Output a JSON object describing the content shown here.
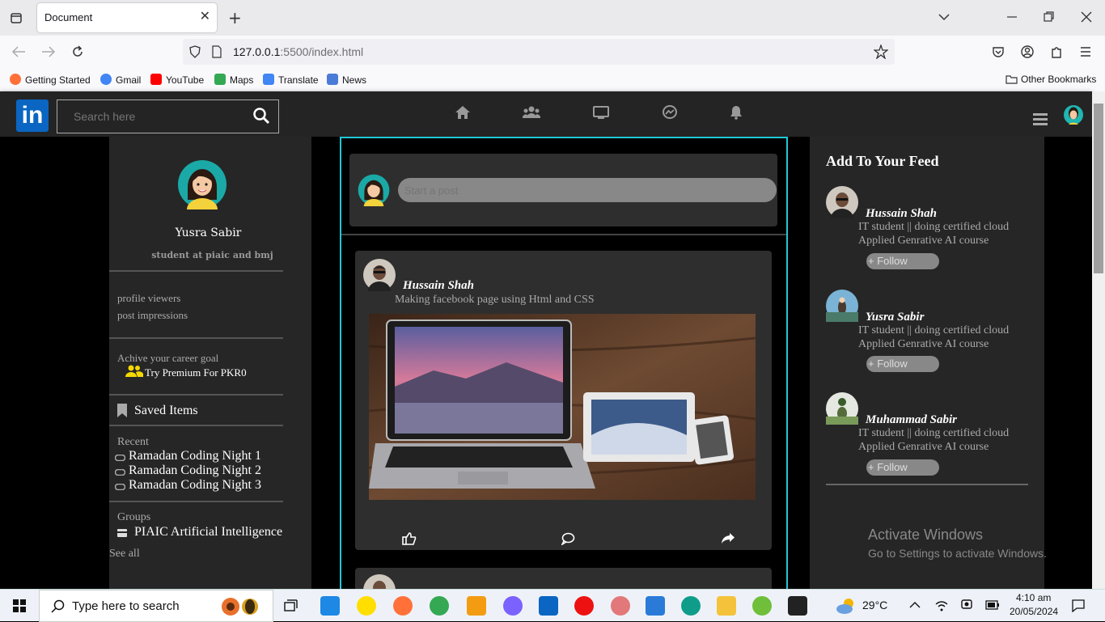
{
  "browser": {
    "tab_title": "Document",
    "url_host": "127.0.0.1",
    "url_rest": ":5500/index.html",
    "bookmarks": [
      {
        "label": "Getting Started",
        "color": "#ff7139"
      },
      {
        "label": "Gmail",
        "color": "#4285f4"
      },
      {
        "label": "YouTube",
        "color": "#ff0000"
      },
      {
        "label": "Maps",
        "color": "#34a853"
      },
      {
        "label": "Translate",
        "color": "#4285f4"
      },
      {
        "label": "News",
        "color": "#4a7bd8"
      }
    ],
    "other_bookmarks": "Other Bookmarks"
  },
  "header": {
    "logo": "in",
    "search_placeholder": "Search here",
    "nav_icons": [
      "home-icon",
      "network-icon",
      "jobs-icon",
      "messaging-icon",
      "notifications-icon"
    ]
  },
  "profile": {
    "name": "Yusra Sabir",
    "headline": "student at piaic and bmj",
    "stats": [
      "profile viewers",
      "post impressions"
    ],
    "goal_text": "Achive your career goal",
    "premium_text": "Try Premium For PKR0",
    "saved_items": "Saved Items",
    "recent_label": "Recent",
    "recent_items": [
      "Ramadan Coding Night 1",
      "Ramadan Coding Night 2",
      "Ramadan Coding Night 3"
    ],
    "groups_label": "Groups",
    "groups_item": "PIAIC Artificial Intelligence",
    "see_all": "See all"
  },
  "composer": {
    "placeholder": "Start a post"
  },
  "post": {
    "author": "Hussain Shah",
    "text": "Making facebook page using Html and CSS",
    "image_alt": "laptop, tablet and phone on a wooden table"
  },
  "feed": {
    "title": "Add To Your Feed",
    "people": [
      {
        "name": "Hussain Shah",
        "desc1": "IT student || doing certified cloud",
        "desc2": "Applied Genrative AI course",
        "follow": "+ Follow"
      },
      {
        "name": "Yusra Sabir",
        "desc1": "IT student || doing certified cloud",
        "desc2": "Applied Genrative AI course",
        "follow": "+ Follow"
      },
      {
        "name": "Muhammad Sabir",
        "desc1": "IT student || doing certified cloud",
        "desc2": "Applied Genrative AI course",
        "follow": "+ Follow"
      }
    ]
  },
  "watermark": {
    "line1": "Activate Windows",
    "line2": "Go to Settings to activate Windows."
  },
  "taskbar": {
    "search_placeholder": "Type here to search",
    "weather": "29°C",
    "time": "4:10 am",
    "date": "20/05/2024"
  }
}
